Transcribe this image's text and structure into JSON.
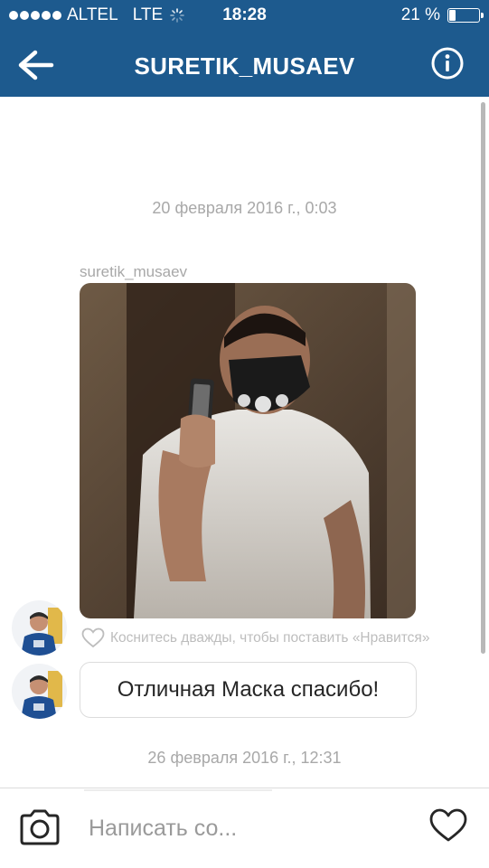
{
  "status_bar": {
    "carrier": "ALTEL",
    "network": "LTE",
    "time": "18:28",
    "battery": "21 %",
    "battery_level": 0.21
  },
  "header": {
    "title": "SURETIK_MUSAEV"
  },
  "thread": {
    "timestamp_1": "20 февраля 2016 г., 0:03",
    "sender_name": "suretik_musaev",
    "like_hint": "Коснитесь дважды, чтобы поставить «Нравится»",
    "message_text": "Отличная Маска спасибо!",
    "timestamp_2": "26 февраля 2016 г., 12:31"
  },
  "composer": {
    "placeholder": "Написать со..."
  },
  "icons": {
    "back": "arrow-left-icon",
    "info": "info-icon",
    "camera": "camera-icon",
    "like": "heart-icon",
    "loading": "spinner-icon"
  },
  "colors": {
    "header_bg": "#1d5a8e",
    "timestamp_text": "#a8a8a8",
    "bubble_border": "#dcdcdc"
  }
}
